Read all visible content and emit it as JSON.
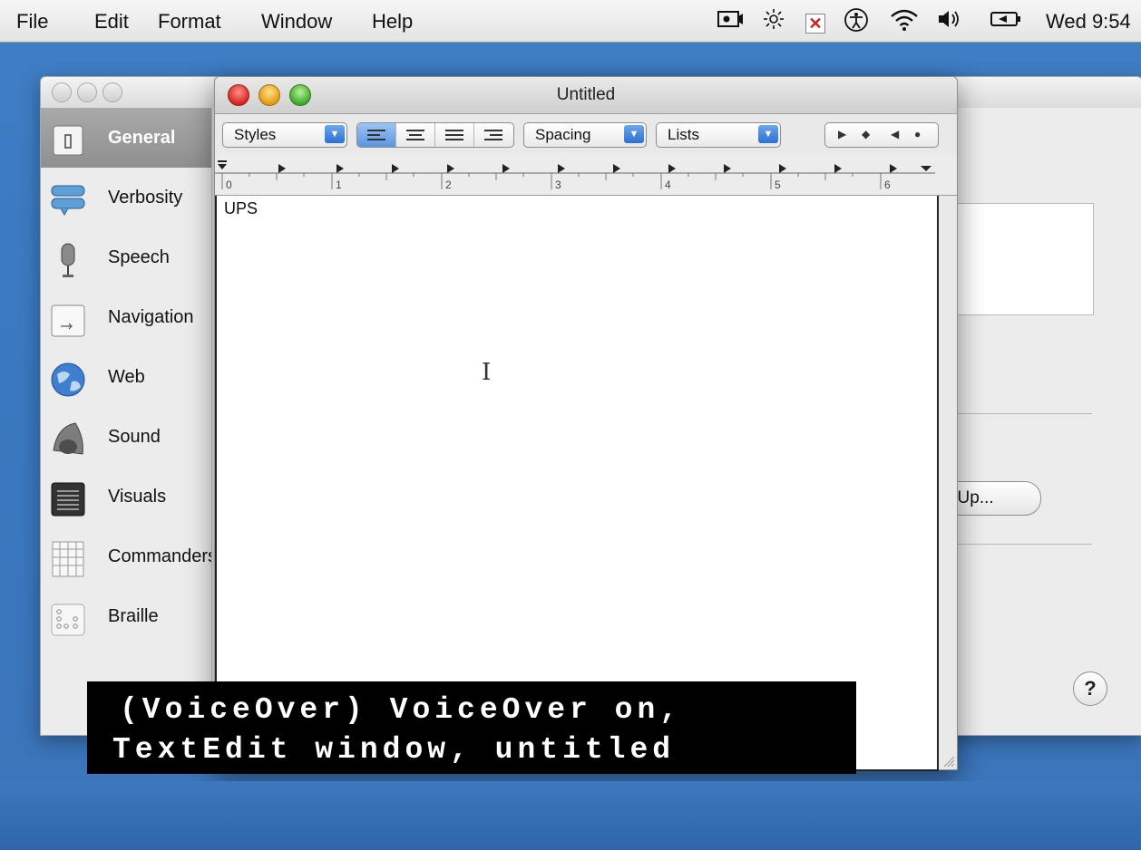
{
  "menubar": {
    "items": [
      "File",
      "Edit",
      "Format",
      "Window",
      "Help"
    ],
    "clock": "Wed 9:54",
    "status_icons": [
      "screen-record-icon",
      "brightness-icon",
      "close-x-icon",
      "accessibility-icon",
      "wifi-icon",
      "volume-icon",
      "battery-icon"
    ]
  },
  "voiceover_utility": {
    "sidebar": [
      {
        "label": "General",
        "icon": "general-icon",
        "selected": true
      },
      {
        "label": "Verbosity",
        "icon": "verbosity-icon"
      },
      {
        "label": "Speech",
        "icon": "microphone-icon"
      },
      {
        "label": "Navigation",
        "icon": "navigation-icon"
      },
      {
        "label": "Web",
        "icon": "globe-icon"
      },
      {
        "label": "Sound",
        "icon": "speaker-icon"
      },
      {
        "label": "Visuals",
        "icon": "visuals-icon"
      },
      {
        "label": "Commanders",
        "icon": "grid-icon"
      },
      {
        "label": "Braille",
        "icon": "braille-icon"
      }
    ],
    "setup_button_label": "t Up...",
    "help_button_label": "?"
  },
  "textedit": {
    "title": "Untitled",
    "toolbar": {
      "styles_label": "Styles",
      "spacing_label": "Spacing",
      "lists_label": "Lists"
    },
    "ruler_numbers": [
      "0",
      "1",
      "2",
      "3",
      "4",
      "5",
      "6"
    ],
    "document_text": "UPS"
  },
  "caption": {
    "line1": "(VoiceOver) VoiceOver on,",
    "line2": "TextEdit window, untitled"
  }
}
